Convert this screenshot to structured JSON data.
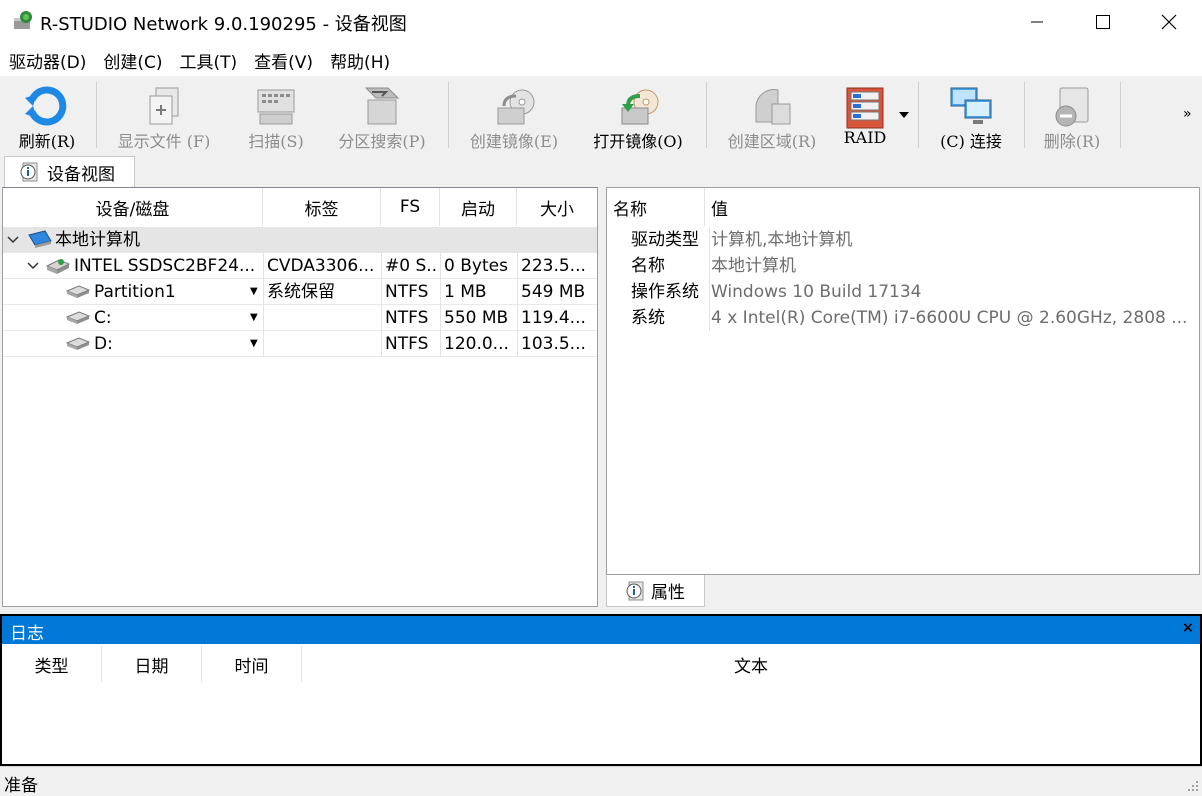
{
  "window": {
    "title": "R-STUDIO Network 9.0.190295 - 设备视图"
  },
  "menu": [
    "驱动器(D)",
    "创建(C)",
    "工具(T)",
    "查看(V)",
    "帮助(H)"
  ],
  "toolbar": {
    "refresh": "刷新(R)",
    "show_files": "显示文件 (F)",
    "scan": "扫描(S)",
    "partition_search": "分区搜索(P)",
    "create_image": "创建镜像(E)",
    "open_image": "打开镜像(O)",
    "create_region": "创建区域(R)",
    "raid": "RAID",
    "connect": "(C) 连接",
    "delete": "删除(R)",
    "more": "»"
  },
  "tabs": {
    "device_view": "设备视图",
    "properties": "属性"
  },
  "device_table": {
    "columns": [
      "设备/磁盘",
      "标签",
      "FS",
      "启动",
      "大小"
    ],
    "rows": [
      {
        "name": "本地计算机",
        "label": "",
        "fs": "",
        "start": "",
        "size": ""
      },
      {
        "name": "INTEL SSDSC2BF24...",
        "label": "CVDA3306...",
        "fs": "#0 S...",
        "start": "0 Bytes",
        "size": "223.5..."
      },
      {
        "name": "Partition1",
        "label": "系统保留",
        "fs": "NTFS",
        "start": "1 MB",
        "size": "549 MB"
      },
      {
        "name": "C:",
        "label": "",
        "fs": "NTFS",
        "start": "550 MB",
        "size": "119.4..."
      },
      {
        "name": "D:",
        "label": "",
        "fs": "NTFS",
        "start": "120.0...",
        "size": "103.5..."
      }
    ]
  },
  "properties": {
    "columns": [
      "名称",
      "值"
    ],
    "rows": [
      {
        "key": "驱动类型",
        "value": "计算机,本地计算机"
      },
      {
        "key": "名称",
        "value": "本地计算机"
      },
      {
        "key": "操作系统",
        "value": "Windows 10 Build 17134"
      },
      {
        "key": "系统",
        "value": "4 x Intel(R) Core(TM) i7-6600U CPU @ 2.60GHz, 2808 ..."
      }
    ]
  },
  "log": {
    "title": "日志",
    "close": "×",
    "columns": [
      "类型",
      "日期",
      "时间",
      "文本"
    ]
  },
  "status": {
    "text": "准备"
  },
  "colors": {
    "accent": "#0078d7",
    "selected_row": "#e5e5e5"
  }
}
